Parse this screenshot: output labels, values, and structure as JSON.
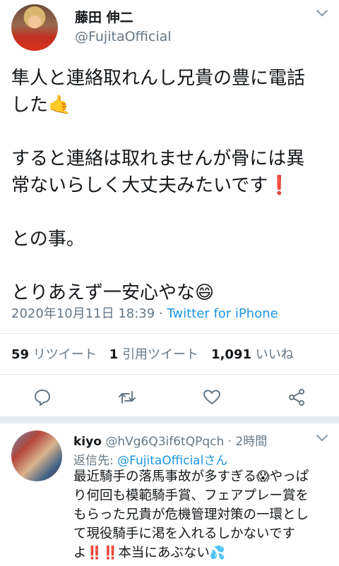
{
  "tweet": {
    "display_name": "藤田 伸二",
    "handle": "@FujitaOfficial",
    "lines": [
      "隼人と連絡取れんし兄貴の豊に電話",
      "した",
      "",
      "すると連絡は取れませんが骨には異",
      "常ないらしく大丈夫みたいです",
      "",
      "との事。",
      "",
      "とりあえず一安心やな"
    ],
    "emoji": {
      "call_me_hand": "🤙",
      "exclamation": "❗",
      "grin": "😄"
    },
    "date": "2020年10月11日 18:39",
    "separator": " · ",
    "source": "Twitter for iPhone"
  },
  "stats": {
    "retweets_count": "59",
    "retweets_label": "リツイート",
    "quotes_count": "1",
    "quotes_label": "引用ツイート",
    "likes_count": "1,091",
    "likes_label": "いいね"
  },
  "actions": [
    "reply-icon",
    "retweet-icon",
    "like-icon",
    "share-icon"
  ],
  "colors": {
    "link": "#1b95e0",
    "secondary": "#657786",
    "primary": "#14171a",
    "divider": "#e1e8ed"
  },
  "reply": {
    "name": "kiyo",
    "handle": "@hVg6Q3if6tQPqch",
    "separator": " · ",
    "time": "2時間",
    "reply_to_label": "返信先: ",
    "reply_to_mention": "@FujitaOfficialさん",
    "lines": [
      "最近騎手の落馬事故が多すぎる",
      "り何回も模範騎手賞、フェアプレー賞を",
      "もらった兄貴が危機管理対策の一環とし",
      "て現役騎手に渇を入れるしかないです",
      "よ"
    ],
    "line1_tail": "やっぱ",
    "line5_tail": "本当にあぶない",
    "emoji": {
      "scream": "😱",
      "double_excl": "‼️",
      "sweat": "💦"
    }
  }
}
